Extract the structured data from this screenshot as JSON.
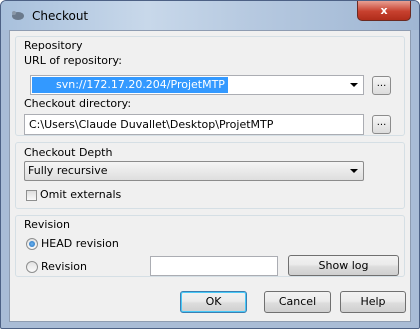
{
  "window": {
    "title": "Checkout",
    "close_label": "x"
  },
  "repository": {
    "group_label": "Repository",
    "url_label": "URL of repository:",
    "url_value": "svn://172.17.20.204/ProjetMTP",
    "browse_label": "...",
    "dir_label": "Checkout directory:",
    "dir_value": "C:\\Users\\Claude Duvallet\\Desktop\\ProjetMTP",
    "dir_browse_label": "..."
  },
  "depth": {
    "group_label": "Checkout Depth",
    "selected": "Fully recursive",
    "omit_externals_label": "Omit externals",
    "omit_externals_checked": false
  },
  "revision": {
    "group_label": "Revision",
    "head_label": "HEAD revision",
    "head_selected": true,
    "revision_label": "Revision",
    "revision_value": "",
    "show_log_label": "Show log"
  },
  "buttons": {
    "ok": "OK",
    "cancel": "Cancel",
    "help": "Help"
  }
}
